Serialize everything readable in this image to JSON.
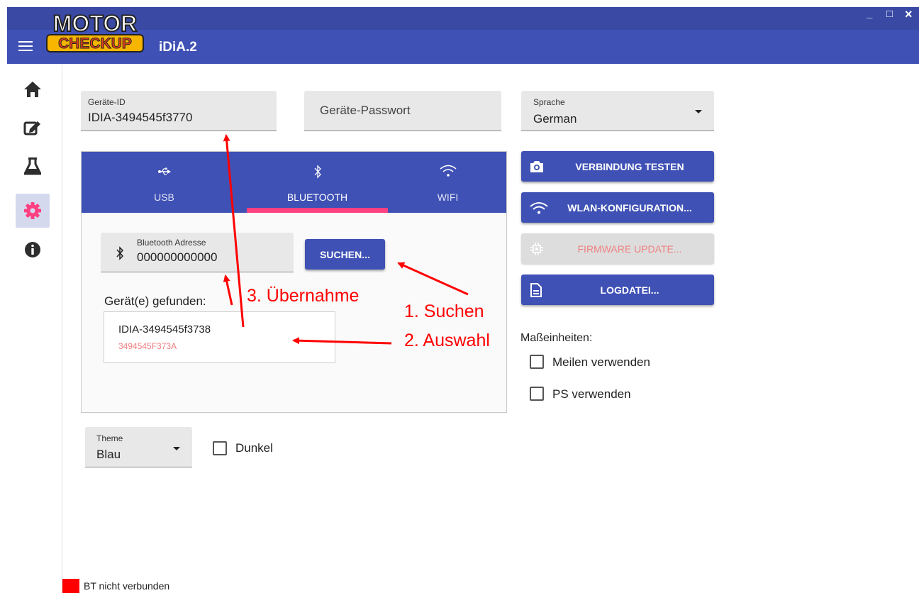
{
  "window": {
    "app_name": "iDiA.2",
    "logo_top": "MOTOR",
    "logo_bottom": "CHECKUP",
    "minimize": "_",
    "maximize": "□",
    "close": "×"
  },
  "sidebar": {
    "items": [
      {
        "icon": "home-icon"
      },
      {
        "icon": "edit-icon"
      },
      {
        "icon": "flask-icon"
      },
      {
        "icon": "gear-icon",
        "active": true
      },
      {
        "icon": "info-icon"
      }
    ]
  },
  "settings": {
    "device_id": {
      "label": "Geräte-ID",
      "value": "IDIA-3494545f3770"
    },
    "device_password": {
      "placeholder": "Geräte-Passwort"
    },
    "language": {
      "label": "Sprache",
      "value": "German"
    },
    "theme": {
      "label": "Theme",
      "value": "Blau"
    },
    "dark": {
      "label": "Dunkel",
      "checked": false
    }
  },
  "connection": {
    "tabs": [
      {
        "label": "USB",
        "icon": "usb-icon"
      },
      {
        "label": "BLUETOOTH",
        "icon": "bluetooth-icon",
        "active": true
      },
      {
        "label": "WIFI",
        "icon": "wifi-icon"
      }
    ],
    "bt_address": {
      "label": "Bluetooth Adresse",
      "value": "000000000000"
    },
    "search_button": "SUCHEN...",
    "found_label": "Gerät(e) gefunden:",
    "devices": [
      {
        "name": "IDIA-3494545f3738",
        "address": "3494545F373A"
      }
    ]
  },
  "actions": {
    "test": "VERBINDUNG TESTEN",
    "wlan": "WLAN-KONFIGURATION...",
    "firmware": "FIRMWARE UPDATE...",
    "log": "LOGDATEI..."
  },
  "units": {
    "label": "Maßeinheiten:",
    "miles": {
      "label": "Meilen verwenden",
      "checked": false
    },
    "ps": {
      "label": "PS verwenden",
      "checked": false
    }
  },
  "status": {
    "text": "BT nicht verbunden",
    "color": "#ff0000"
  },
  "annotations": {
    "step1": "1. Suchen",
    "step2": "2. Auswahl",
    "step3": "3. Übernahme",
    "color": "#ff0000"
  },
  "colors": {
    "primary": "#3f51b5",
    "accent": "#ff4081",
    "disabled_text": "#f08080"
  }
}
